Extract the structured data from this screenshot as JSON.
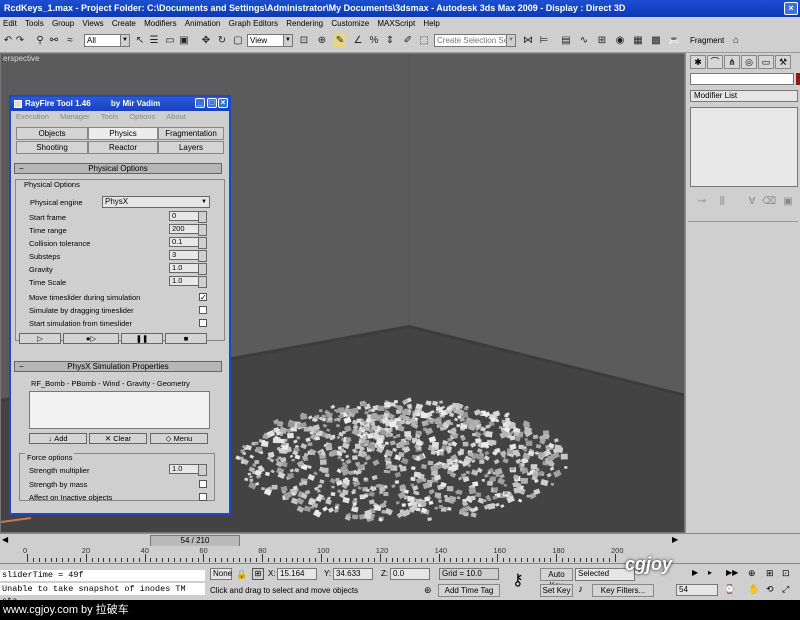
{
  "window": {
    "title": "RcdKeys_1.max    - Project Folder: C:\\Documents and Settings\\Administrator\\My Documents\\3dsmax    - Autodesk 3ds Max  2009          - Display : Direct 3D"
  },
  "menu": [
    "Edit",
    "Tools",
    "Group",
    "Views",
    "Create",
    "Modifiers",
    "Animation",
    "Graph Editors",
    "Rendering",
    "Customize",
    "MAXScript",
    "Help"
  ],
  "toolbar": {
    "filter_value": "All",
    "refcoord_value": "View",
    "selection_set_placeholder": "Create Selection Set",
    "fragment_label": "Fragment"
  },
  "viewport": {
    "label": "erspective"
  },
  "cmdpanel": {
    "modifier_list": "Modifier List"
  },
  "rayfire": {
    "title": "RayFire Tool 1.46",
    "author": "by Mir Vadim",
    "menu": [
      "Execution",
      "Manager",
      "Tools",
      "Options",
      "About"
    ],
    "tabs_row1": [
      "Objects",
      "Physics",
      "Fragmentation"
    ],
    "tabs_row2": [
      "Shooting",
      "Reactor",
      "Layers"
    ],
    "physical_options_header": "Physical Options",
    "physical_options_group": "Physical Options",
    "engine_label": "Physical engine",
    "engine_value": "PhysX",
    "fields": [
      {
        "label": "Start frame",
        "value": "0"
      },
      {
        "label": "Time range",
        "value": "200"
      },
      {
        "label": "Collision tolerance",
        "value": "0.1"
      },
      {
        "label": "Substeps",
        "value": "3"
      },
      {
        "label": "Gravity",
        "value": "1.0"
      },
      {
        "label": "Time Scale",
        "value": "1.0"
      }
    ],
    "checks": [
      {
        "label": "Move timeslider during simulation",
        "checked": "✓"
      },
      {
        "label": "Simulate by dragging timeslider",
        "checked": ""
      },
      {
        "label": "Start simulation from timeslider",
        "checked": ""
      }
    ],
    "physx_header": "PhysX Simulation Properties",
    "physx_list_label": "RF_Bomb - PBomb - Wind - Gravity - Geometry",
    "add_label": "Add",
    "clear_label": "Clear",
    "menu_label": "Menu",
    "force_group": "Force options",
    "force_fields": [
      {
        "label": "Strength multiplier",
        "value": "1.0"
      }
    ],
    "force_checks": [
      {
        "label": "Strength by mass",
        "checked": ""
      },
      {
        "label": "Affect on Inactive objects",
        "checked": ""
      }
    ]
  },
  "timeline": {
    "slider_label": "54 / 210",
    "ticks": [
      "0",
      "20",
      "40",
      "60",
      "80",
      "100",
      "120",
      "140",
      "160",
      "180",
      "200"
    ]
  },
  "status": {
    "maxscript_line1": "sliderTime = 49f",
    "maxscript_line2": "Unable to take snapshot of inodes TM sta",
    "selection": "None",
    "x_label": "X:",
    "x_value": "15.164",
    "y_label": "Y:",
    "y_value": "34.633",
    "z_label": "Z:",
    "z_value": "0.0",
    "grid": "Grid = 10.0",
    "prompt": "Click and drag to select and move objects",
    "add_time_tag": "Add Time Tag",
    "auto_key": "Auto Key",
    "set_key": "Set Key",
    "selected_value": "Selected",
    "key_filters": "Key Filters...",
    "frame_value": "54"
  },
  "watermark": {
    "logo": "cgjoy",
    "footer": "www.cgjoy.com by 拉破车"
  }
}
